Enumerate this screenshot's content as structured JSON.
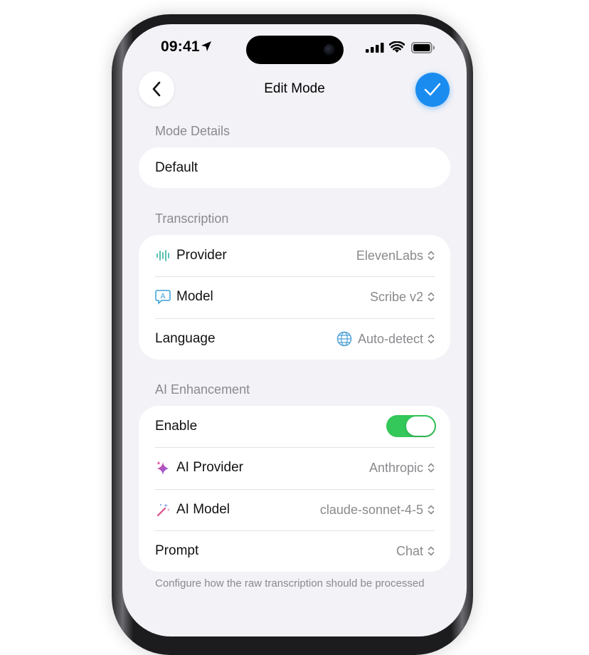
{
  "status_bar": {
    "time": "09:41",
    "location_icon": "location-arrow-icon",
    "signal_icon": "cellular-signal-icon",
    "wifi_icon": "wifi-icon",
    "battery_icon": "battery-icon"
  },
  "nav": {
    "title": "Edit Mode",
    "back_icon": "chevron-left-icon",
    "done_icon": "checkmark-icon",
    "accent_color": "#1a8cf0"
  },
  "mode_details": {
    "header": "Mode Details",
    "name_value": "Default"
  },
  "transcription": {
    "header": "Transcription",
    "rows": [
      {
        "label": "Provider",
        "icon": "waveform-icon",
        "value": "ElevenLabs"
      },
      {
        "label": "Model",
        "icon": "speech-bubble-a-icon",
        "value": "Scribe v2"
      },
      {
        "label": "Language",
        "icon": "globe-icon",
        "value": "Auto-detect"
      }
    ]
  },
  "ai_enhancement": {
    "header": "AI Enhancement",
    "enable_label": "Enable",
    "enabled": true,
    "toggle_color": "#34c759",
    "rows": [
      {
        "label": "AI Provider",
        "icon": "sparkles-icon",
        "value": "Anthropic"
      },
      {
        "label": "AI Model",
        "icon": "magic-wand-icon",
        "value": "claude-sonnet-4-5"
      },
      {
        "label": "Prompt",
        "value": "Chat"
      }
    ],
    "footer": "Configure how the raw transcription should be processed"
  }
}
